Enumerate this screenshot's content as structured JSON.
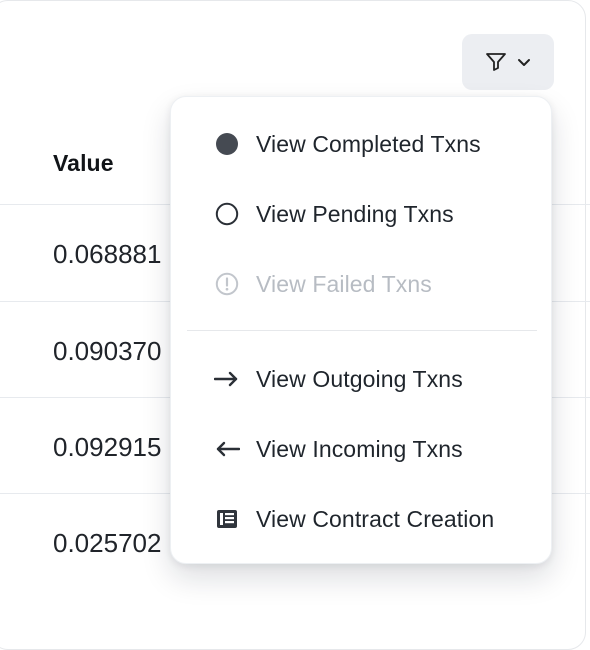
{
  "table": {
    "header": {
      "value": "Value"
    },
    "rows": [
      {
        "value": "0.068881"
      },
      {
        "value": "0.090370"
      },
      {
        "value": "0.092915"
      },
      {
        "value": "0.025702"
      }
    ]
  },
  "filter": {
    "icon": "filter-icon",
    "chevron": "chevron-down-icon"
  },
  "dropdown": {
    "items": [
      {
        "label": "View Completed Txns",
        "icon": "completed-status-icon",
        "enabled": true
      },
      {
        "label": "View Pending Txns",
        "icon": "pending-status-icon",
        "enabled": true
      },
      {
        "label": "View Failed Txns",
        "icon": "failed-status-icon",
        "enabled": false
      },
      {
        "label": "View Outgoing Txns",
        "icon": "arrow-right-icon",
        "enabled": true
      },
      {
        "label": "View Incoming Txns",
        "icon": "arrow-left-icon",
        "enabled": true
      },
      {
        "label": "View Contract Creation",
        "icon": "contract-icon",
        "enabled": true
      }
    ]
  },
  "colors": {
    "text": "#1f252c",
    "muted": "#b7bcc3",
    "border": "#e7eaee",
    "button_bg": "#eceef2",
    "dot": "#454a52"
  }
}
